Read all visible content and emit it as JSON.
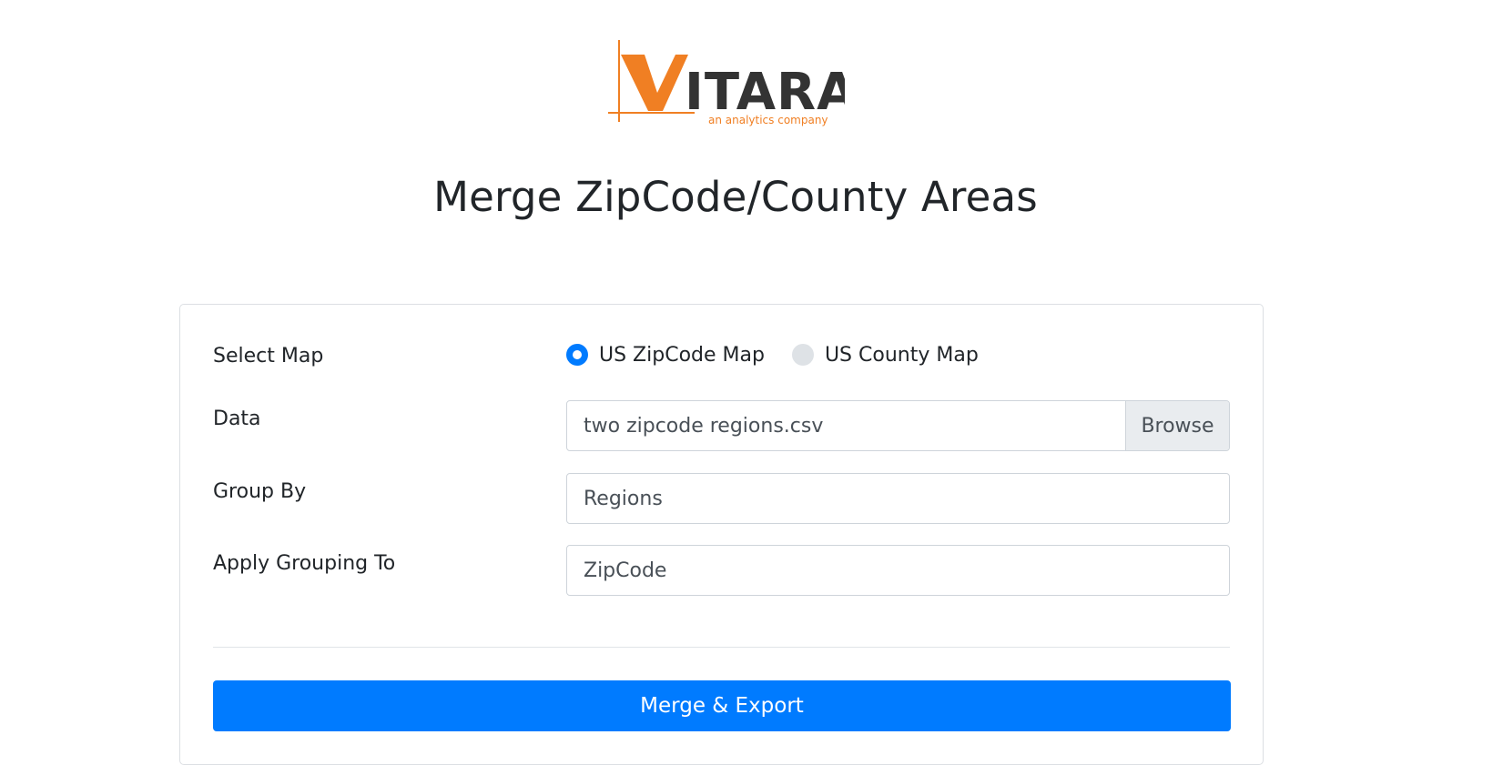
{
  "logo": {
    "brand": "VITARA",
    "tagline": "an analytics company",
    "brand_orange": "#F07F23",
    "brand_dark": "#333333"
  },
  "page": {
    "title": "Merge ZipCode/County Areas"
  },
  "form": {
    "select_map": {
      "label": "Select Map",
      "options": [
        {
          "label": "US ZipCode Map",
          "checked": true
        },
        {
          "label": "US County Map",
          "checked": false
        }
      ]
    },
    "data": {
      "label": "Data",
      "file_name": "two zipcode regions.csv",
      "browse_label": "Browse"
    },
    "group_by": {
      "label": "Group By",
      "value": "Regions"
    },
    "apply_grouping_to": {
      "label": "Apply Grouping To",
      "value": "ZipCode"
    },
    "submit": {
      "label": "Merge & Export"
    }
  },
  "colors": {
    "primary": "#007BFF",
    "radio_unchecked": "#DEE2E6",
    "input_border": "#CED4DA",
    "browse_bg": "#E9ECEF"
  }
}
